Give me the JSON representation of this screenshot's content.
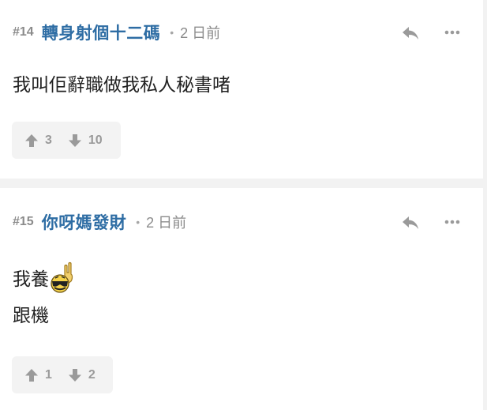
{
  "posts": [
    {
      "floor": "#14",
      "username": "轉身射個十二碼",
      "separator": "•",
      "time": "2 日前",
      "content_lines": [
        "我叫佢辭職做我私人秘書啫"
      ],
      "upvotes": "3",
      "downvotes": "10"
    },
    {
      "floor": "#15",
      "username": "你呀媽發財",
      "separator": "•",
      "time": "2 日前",
      "content_lines": [
        "我養",
        "跟機"
      ],
      "emoji": "sticker-emoji",
      "upvotes": "1",
      "downvotes": "2"
    }
  ],
  "icons": {
    "reply": "reply-icon",
    "more": "more-icon",
    "upvote": "arrow-up-icon",
    "downvote": "arrow-down-icon"
  },
  "colors": {
    "username": "#2e6da4",
    "meta": "#8b8b8b",
    "text": "#222222",
    "vote_bg": "#f3f3f3",
    "page_bg": "#f2f2f2"
  }
}
